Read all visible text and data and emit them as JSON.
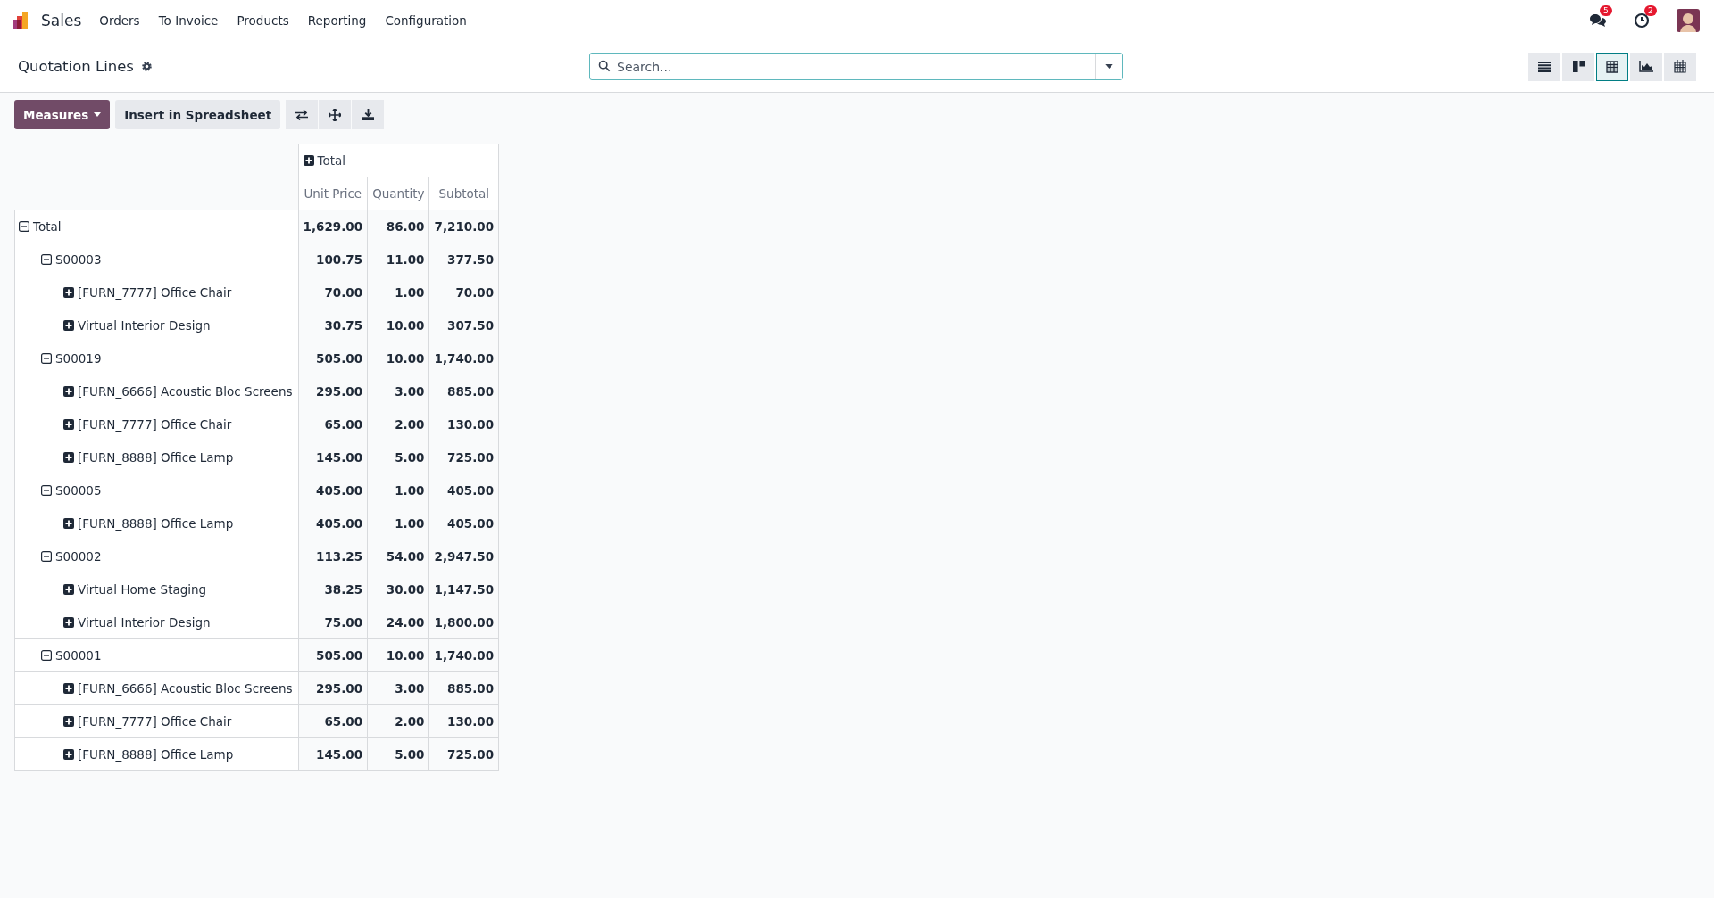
{
  "navbar": {
    "app_name": "Sales",
    "menu": [
      "Orders",
      "To Invoice",
      "Products",
      "Reporting",
      "Configuration"
    ],
    "messages_count": "5",
    "activities_count": "2"
  },
  "control_panel": {
    "title": "Quotation Lines",
    "search": {
      "placeholder": "Search..."
    },
    "views": [
      {
        "kind": "list",
        "selected": false
      },
      {
        "kind": "kanban",
        "selected": false
      },
      {
        "kind": "pivot",
        "selected": true
      },
      {
        "kind": "graph",
        "selected": false
      },
      {
        "kind": "calendar",
        "selected": false
      }
    ]
  },
  "toolbar": {
    "measures_button": "Measures",
    "insert_button": "Insert in Spreadsheet"
  },
  "pivot": {
    "column_header": {
      "label": "Total",
      "expanded": false
    },
    "measures": [
      "Unit Price",
      "Quantity",
      "Subtotal"
    ],
    "rows": [
      {
        "label": "Total",
        "expanded": true,
        "values": [
          "1,629.00",
          "86.00",
          "7,210.00"
        ],
        "children": [
          {
            "label": "S00003",
            "expanded": true,
            "values": [
              "100.75",
              "11.00",
              "377.50"
            ],
            "children": [
              {
                "label": "[FURN_7777] Office Chair",
                "expanded": false,
                "values": [
                  "70.00",
                  "1.00",
                  "70.00"
                ]
              },
              {
                "label": "Virtual Interior Design",
                "expanded": false,
                "values": [
                  "30.75",
                  "10.00",
                  "307.50"
                ]
              }
            ]
          },
          {
            "label": "S00019",
            "expanded": true,
            "values": [
              "505.00",
              "10.00",
              "1,740.00"
            ],
            "children": [
              {
                "label": "[FURN_6666] Acoustic Bloc Screens",
                "expanded": false,
                "values": [
                  "295.00",
                  "3.00",
                  "885.00"
                ]
              },
              {
                "label": "[FURN_7777] Office Chair",
                "expanded": false,
                "values": [
                  "65.00",
                  "2.00",
                  "130.00"
                ]
              },
              {
                "label": "[FURN_8888] Office Lamp",
                "expanded": false,
                "values": [
                  "145.00",
                  "5.00",
                  "725.00"
                ]
              }
            ]
          },
          {
            "label": "S00005",
            "expanded": true,
            "values": [
              "405.00",
              "1.00",
              "405.00"
            ],
            "children": [
              {
                "label": "[FURN_8888] Office Lamp",
                "expanded": false,
                "values": [
                  "405.00",
                  "1.00",
                  "405.00"
                ]
              }
            ]
          },
          {
            "label": "S00002",
            "expanded": true,
            "values": [
              "113.25",
              "54.00",
              "2,947.50"
            ],
            "children": [
              {
                "label": "Virtual Home Staging",
                "expanded": false,
                "values": [
                  "38.25",
                  "30.00",
                  "1,147.50"
                ]
              },
              {
                "label": "Virtual Interior Design",
                "expanded": false,
                "values": [
                  "75.00",
                  "24.00",
                  "1,800.00"
                ]
              }
            ]
          },
          {
            "label": "S00001",
            "expanded": true,
            "values": [
              "505.00",
              "10.00",
              "1,740.00"
            ],
            "children": [
              {
                "label": "[FURN_6666] Acoustic Bloc Screens",
                "expanded": false,
                "values": [
                  "295.00",
                  "3.00",
                  "885.00"
                ]
              },
              {
                "label": "[FURN_7777] Office Chair",
                "expanded": false,
                "values": [
                  "65.00",
                  "2.00",
                  "130.00"
                ]
              },
              {
                "label": "[FURN_8888] Office Lamp",
                "expanded": false,
                "values": [
                  "145.00",
                  "5.00",
                  "725.00"
                ]
              }
            ]
          }
        ]
      }
    ]
  }
}
